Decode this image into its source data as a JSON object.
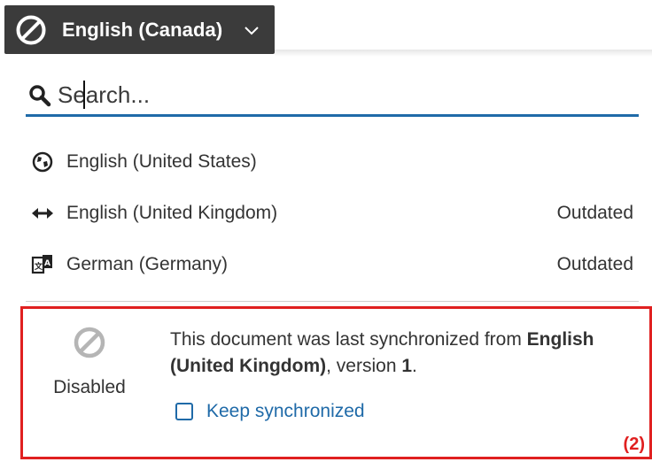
{
  "language_selector": {
    "current_language": "English (Canada)",
    "icon": "disabled-circle-icon",
    "chevron": "chevron-down-icon"
  },
  "search": {
    "placeholder": "Search..."
  },
  "languages": [
    {
      "label": "English (United States)",
      "status": "",
      "icon": "globe-icon"
    },
    {
      "label": "English (United Kingdom)",
      "status": "Outdated",
      "icon": "bidirectional-arrow-icon"
    },
    {
      "label": "German (Germany)",
      "status": "Outdated",
      "icon": "translate-icon"
    }
  ],
  "sync_info": {
    "state_label": "Disabled",
    "state_icon": "disabled-circle-icon",
    "message_prefix": "This document was last synchronized from ",
    "source_language": "English (United Kingdom)",
    "message_middle": ", version ",
    "version": "1",
    "message_suffix": ".",
    "keep_sync_label": "Keep synchronized",
    "keep_sync_checked": false
  },
  "annotation": {
    "callout_label": "(2)"
  },
  "colors": {
    "button_bg": "#3b3b3b",
    "accent_blue": "#1f6aa8",
    "highlight_red": "#e02020"
  }
}
